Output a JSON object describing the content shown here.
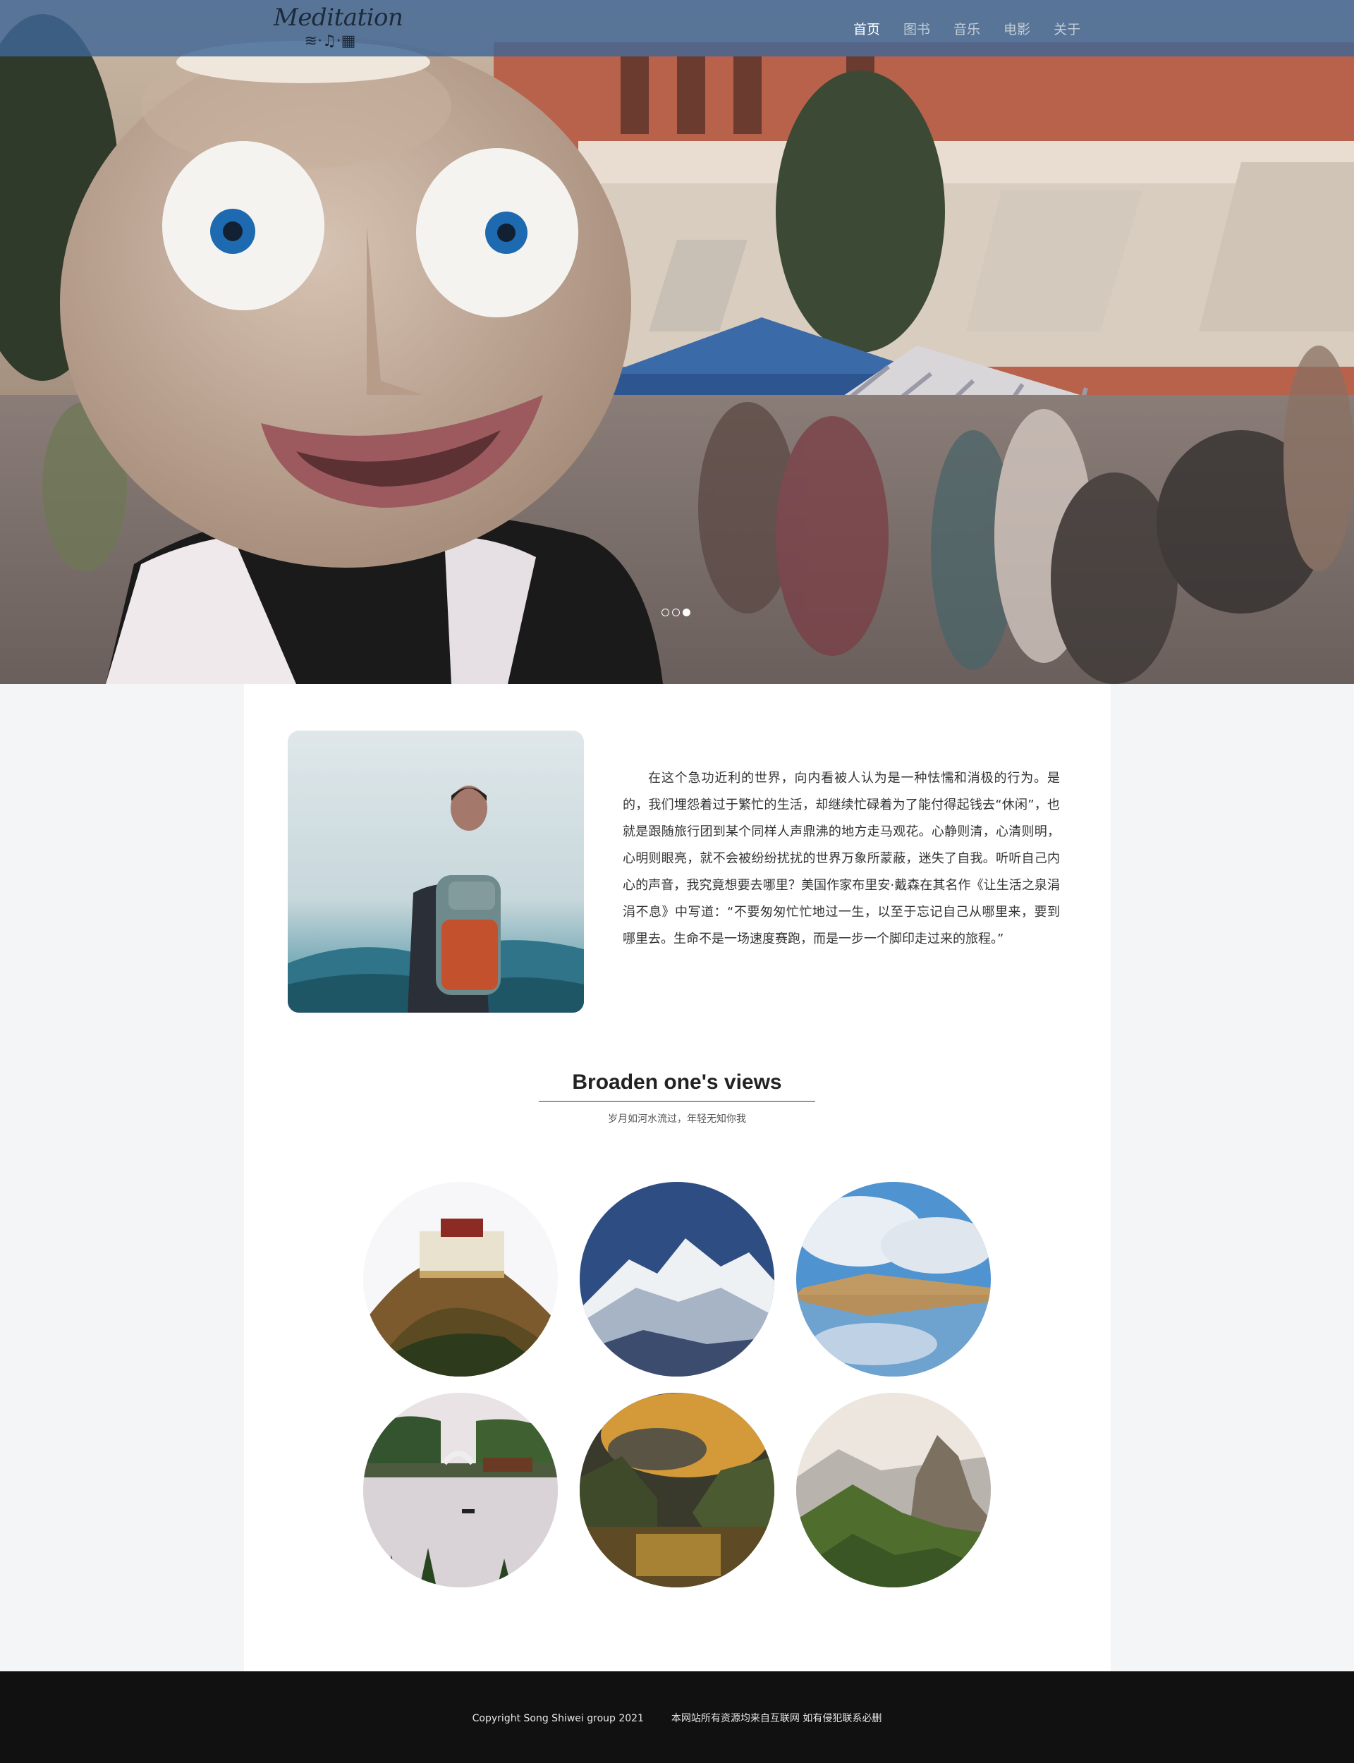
{
  "brand": {
    "logo_text": "Meditation",
    "logo_icons": "≋·♫·▦"
  },
  "nav": {
    "items": [
      {
        "label": "首页",
        "active": true
      },
      {
        "label": "图书",
        "active": false
      },
      {
        "label": "音乐",
        "active": false
      },
      {
        "label": "电影",
        "active": false
      },
      {
        "label": "关于",
        "active": false
      }
    ]
  },
  "carousel": {
    "slide_count": 3,
    "active_index": 2
  },
  "intro": {
    "paragraph": "在这个急功近利的世界，向内看被人认为是一种怯懦和消极的行为。是的，我们埋怨着过于繁忙的生活，却继续忙碌着为了能付得起钱去“休闲”，也就是跟随旅行团到某个同样人声鼎沸的地方走马观花。心静则清，心清则明，心明则眼亮，就不会被纷纷扰扰的世界万象所蒙蔽，迷失了自我。听听自己内心的声音，我究竟想要去哪里？美国作家布里安·戴森在其名作《让生活之泉涓涓不息》中写道：“不要匆匆忙忙地过一生，以至于忘记自己从哪里来，要到哪里去。生命不是一场速度赛跑，而是一步一个脚印走过来的旅程。”"
  },
  "section": {
    "title": "Broaden one's views",
    "subtitle": "岁月如河水流过，年轻无知你我"
  },
  "gallery": {
    "items": [
      {
        "icon": "palace-photo"
      },
      {
        "icon": "snow-mountain-photo"
      },
      {
        "icon": "lake-reflection-photo"
      },
      {
        "icon": "west-lake-bridge-photo"
      },
      {
        "icon": "river-gorge-sunset-photo"
      },
      {
        "icon": "rocky-peak-photo"
      }
    ]
  },
  "footer": {
    "copyright": "Copyright Song Shiwei group 2021",
    "notice": "本网站所有资源均来自互联网 如有侵犯联系必删"
  },
  "colors": {
    "navbar": "#406696",
    "footer": "#111111",
    "page_bg": "#f4f5f7",
    "panel_bg": "#ffffff"
  }
}
